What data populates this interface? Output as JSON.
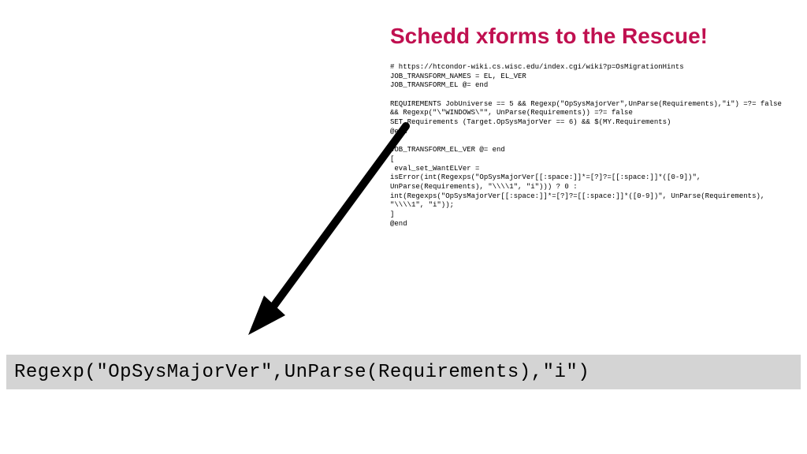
{
  "title": "Schedd xforms to the Rescue!",
  "code": "# https://htcondor-wiki.cs.wisc.edu/index.cgi/wiki?p=OsMigrationHints\nJOB_TRANSFORM_NAMES = EL, EL_VER\nJOB_TRANSFORM_EL @= end\n\nREQUIREMENTS JobUniverse == 5 && Regexp(\"OpSysMajorVer\",UnParse(Requirements),\"i\") =?= false && Regexp(\"\\\"WINDOWS\\\"\", UnParse(Requirements)) =?= false\nSET Requirements (Target.OpSysMajorVer == 6) && $(MY.Requirements)\n@end\n\nJOB_TRANSFORM_EL_VER @= end\n[\n eval_set_WantELVer =\nisError(int(Regexps(\"OpSysMajorVer[[:space:]]*=[?]?=[[:space:]]*([0-9])\",\nUnParse(Requirements), \"\\\\\\\\1\", \"i\"))) ? 0 :\nint(Regexps(\"OpSysMajorVer[[:space:]]*=[?]?=[[:space:]]*([0-9])\", UnParse(Requirements),\n\"\\\\\\\\1\", \"i\"));\n]\n@end",
  "highlight": "Regexp(\"OpSysMajorVer\",UnParse(Requirements),\"i\")"
}
